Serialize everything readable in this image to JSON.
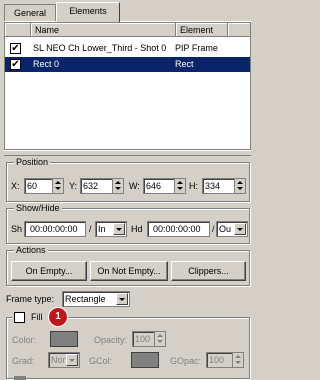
{
  "tabs": [
    {
      "label": "General"
    },
    {
      "label": "Elements"
    }
  ],
  "list": {
    "columns": {
      "name": "Name",
      "element": "Element"
    },
    "rows": [
      {
        "name": "SL NEO Ch Lower_Third - Shot 0",
        "element": "PIP Frame",
        "checked": true,
        "selected": false
      },
      {
        "name": "Rect 0",
        "element": "Rect",
        "checked": true,
        "selected": true
      }
    ]
  },
  "position": {
    "title": "Position",
    "x_label": "X:",
    "x_value": "60",
    "y_label": "Y:",
    "y_value": "632",
    "w_label": "W:",
    "w_value": "646",
    "h_label": "H:",
    "h_value": "334"
  },
  "showhide": {
    "title": "Show/Hide",
    "show_label": "Sh",
    "show_time": "00:00:00:00",
    "show_sep": "/",
    "show_mode": "In",
    "hide_label": "Hd",
    "hide_time": "00:00:00:00",
    "hide_sep": "/",
    "hide_mode": "Ou"
  },
  "actions": {
    "title": "Actions",
    "on_empty": "On Empty...",
    "on_not_empty": "On Not Empty...",
    "clippers": "Clippers..."
  },
  "frame_type": {
    "label": "Frame type:",
    "value": "Rectangle"
  },
  "fill": {
    "label": "Fill",
    "checked": false,
    "color_label": "Color:",
    "opacity_label": "Opacity:",
    "opacity_value": "100",
    "grad_label": "Grad:",
    "grad_value": "Non",
    "gcol_label": "GCol:",
    "gopac_label": "GOpac:",
    "gopac_value": "100"
  },
  "annotation": {
    "number": "1"
  }
}
